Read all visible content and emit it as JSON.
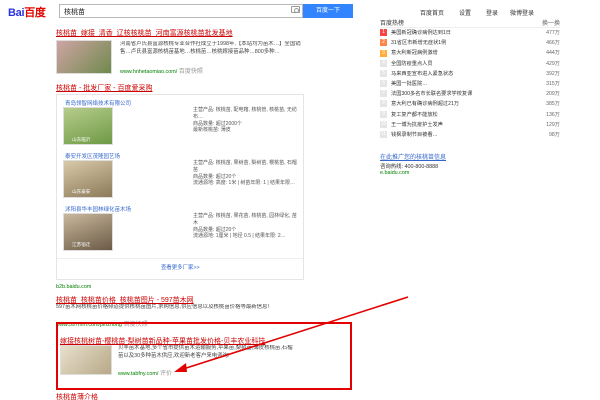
{
  "header": {
    "logo_bai": "Bai",
    "logo_du": "百度",
    "query": "核桃苗",
    "search_button": "百度一下",
    "nav": [
      "百度首页",
      "设置",
      "登录",
      "微博登录"
    ]
  },
  "results": [
    {
      "title": "核桃苗_嫁接_清香_辽核核桃苗_河南富源核桃苗批发基地",
      "desc": "河南省卢氏县富源核桃专业合作社成立于1998年,【本站均为苗木…】全国销售…卢氏县富源核桃苗基地…核桃苗…核桃嫁接苗品种…800多种…",
      "url": "www.hnhetaomiao.com/",
      "snapshot": "百度快照"
    },
    {
      "title": "核桃苗 - 批发厂家 - 百度爱采购",
      "company1": "青岛领智网络技术有限公司",
      "prod1": "主营产品: 核桃苗, 配电箱, 核桃管, 核桃苗, 无纺布…",
      "prod1b": "商品数量: 超过2000个",
      "prod1c": "最新核桃苗: 薄皮",
      "company2": "泰安开发区茂隆园艺场",
      "prod2": "主营产品: 核桃苗, 果树苗, 梨树苗, 樱桃苗, 石榴苗",
      "prod2b": "商品数量: 超过20个",
      "prod2c": "流通源地: 高度: 1米 | 树苗年限: 1 | 结果年限…",
      "company3": "沭阳县华丰园林绿化苗木场",
      "prod3": "主营产品: 核桃苗, 果花苗, 核桃苗, 园林绿化, 苗木",
      "prod3b": "商品数量: 超过20个",
      "prod3c": "流通源地: 1厘米 | 地径 0.5 | 结果年限: 2…",
      "more": "查看更多厂家>>",
      "thumb1": "山东临沂",
      "thumb2": "山东泰安",
      "thumb3": "江苏宿迁",
      "url": "b2b.baidu.com"
    },
    {
      "title": "核桃苗_核桃苗价格_核桃苗图片 - 597苗木网",
      "desc": "597苗木网核桃苗价格频道提供核桃苗图片,求购信息,供应信息以及核桃苗价格等最新信息!",
      "url": "www.597mm.com/pinzhong",
      "snapshot": "百度快照"
    },
    {
      "title": "嫁接核桃树苗-樱桃苗-梨树苗新品种-苹果苗批发价格-贝丰农业科技",
      "desc": "贝丰苗木基地,多个省市提供苗木运输服务,苹果苗,梨树苗,薄皮核桃苗,石榴苗以及30多种苗木供应,欢迎新老客户来电咨询!",
      "url": "www.tabfny.com/",
      "snapshot": "评价"
    },
    {
      "title": "核桃苗薄介格"
    }
  ],
  "sidebar": {
    "title": "百度热榜",
    "title_right": "换一换",
    "items": [
      {
        "n": "1",
        "text": "美国新冠确诊病例达到1日",
        "count": "477万"
      },
      {
        "n": "2",
        "text": "31省区市新增无症状1例",
        "count": "466万"
      },
      {
        "n": "3",
        "text": "意大利新冠病例激增",
        "count": "444万"
      },
      {
        "n": "4",
        "text": "全国防疫重点人员",
        "count": "429万"
      },
      {
        "n": "5",
        "text": "马来西亚宣布进入紧急状态",
        "count": "392万"
      },
      {
        "n": "6",
        "text": "美国一批医院…",
        "count": "315万"
      },
      {
        "n": "7",
        "text": "法国300多名市长联名要求学校复课",
        "count": "209万"
      },
      {
        "n": "8",
        "text": "意大利已有确诊病例超过21万",
        "count": "385万"
      },
      {
        "n": "9",
        "text": "复工复产都不能放松",
        "count": "136万"
      },
      {
        "n": "10",
        "text": "王一博为抗疫护士发声",
        "count": "129万"
      },
      {
        "n": "11",
        "text": "钱枫录制节目被看…",
        "count": "98万"
      }
    ],
    "ad_title": "在此推广您的核桃苗信息",
    "ad_phone": "咨询热线: 400-800-8888",
    "ad_url": "e.baidu.com"
  }
}
